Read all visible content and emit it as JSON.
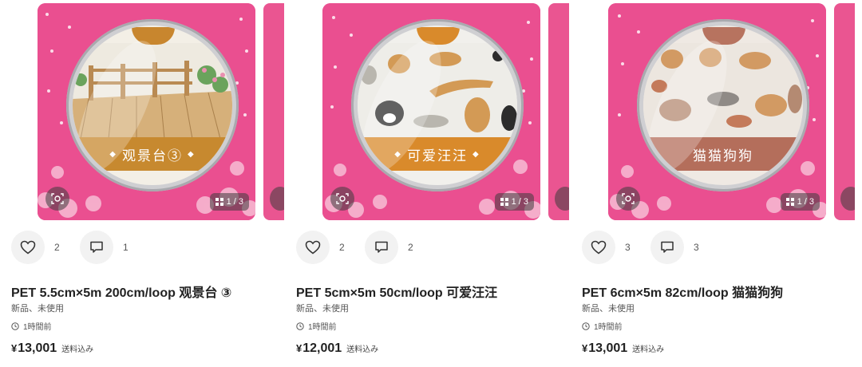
{
  "items": [
    {
      "title": "PET 5.5cm×5m 200cm/loop 观景台 ③",
      "condition": "新品、未使用",
      "time": "1時間前",
      "price": "13,001",
      "currency": "¥",
      "shipping": "送料込み",
      "likes": "2",
      "comments": "1",
      "image_counter": "1 / 3",
      "tape_label": "观景台③",
      "tape_color": "#c8862e",
      "tape_label_bg": "#c7892f"
    },
    {
      "title": "PET 5cm×5m 50cm/loop 可爱汪汪",
      "condition": "新品、未使用",
      "time": "1時間前",
      "price": "12,001",
      "currency": "¥",
      "shipping": "送料込み",
      "likes": "2",
      "comments": "2",
      "image_counter": "1 / 3",
      "tape_label": "可爱汪汪",
      "tape_color": "#d98a2b",
      "tape_label_bg": "#d98a2b"
    },
    {
      "title": "PET 6cm×5m 82cm/loop 猫猫狗狗",
      "condition": "新品、未使用",
      "time": "1時間前",
      "price": "13,001",
      "currency": "¥",
      "shipping": "送料込み",
      "likes": "3",
      "comments": "3",
      "image_counter": "1 / 3",
      "tape_label": "猫猫狗狗",
      "tape_color": "#b7735f",
      "tape_label_bg": "#b46e5b"
    }
  ],
  "colors": {
    "background": "#ffffff",
    "photo_pink": "#ea4f90",
    "button_bg": "#f2f2f2",
    "text": "#222222"
  },
  "icons": [
    "heart-icon",
    "comment-icon",
    "lens-icon",
    "grid-icon",
    "clock-icon"
  ]
}
